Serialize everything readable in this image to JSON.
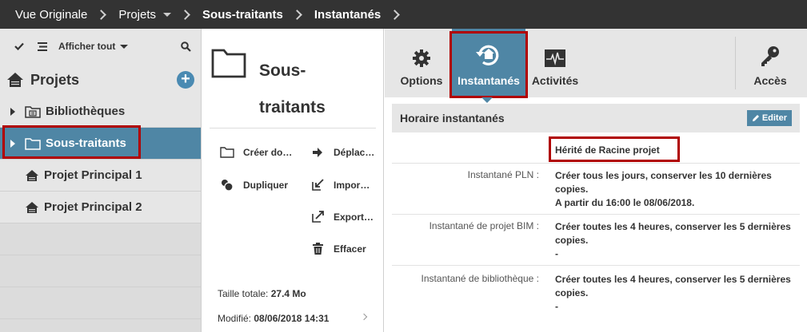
{
  "breadcrumb": {
    "items": [
      "Vue Originale",
      "Projets",
      "Sous-traitants",
      "Instantanés"
    ]
  },
  "left": {
    "toolbar": {
      "show_all": "Afficher tout"
    },
    "projects_title": "Projets",
    "tree": [
      {
        "label": "Bibliothèques",
        "icon": "library-folder-icon",
        "expandable": true,
        "selected": false
      },
      {
        "label": "Sous-traitants",
        "icon": "folder-icon",
        "expandable": true,
        "selected": true
      },
      {
        "label": "Projet Principal 1",
        "icon": "project-house-icon",
        "expandable": false,
        "selected": false
      },
      {
        "label": "Projet Principal 2",
        "icon": "project-house-icon",
        "expandable": false,
        "selected": false
      }
    ]
  },
  "middle": {
    "title_line1": "Sous-",
    "title_line2": "traitants",
    "actions": {
      "create": "Créer do…",
      "move": "Déplac…",
      "duplicate": "Dupliquer",
      "import": "Impor…",
      "export": "Export…",
      "delete": "Effacer"
    },
    "size_label": "Taille totale:",
    "size_value": "27.4 Mo",
    "modified_label": "Modifié:",
    "modified_value": "08/06/2018 14:31"
  },
  "right": {
    "tabs": {
      "options": "Options",
      "snapshots": "Instantanés",
      "activities": "Activités",
      "access": "Accès"
    },
    "section_title": "Horaire instantanés",
    "edit_label": "Editer",
    "inherited": "Hérité de Racine projet",
    "rows": [
      {
        "label": "Instantané PLN :",
        "value_line1": "Créer tous les jours, conserver les 10 dernières",
        "value_line2": "copies.",
        "value_line3": "A partir du 16:00 le 08/06/2018."
      },
      {
        "label": "Instantané de projet BIM :",
        "value_line1": "Créer toutes les 4 heures, conserver les 5 dernières",
        "value_line2": "copies.",
        "value_line3": "-"
      },
      {
        "label": "Instantané de bibliothèque :",
        "value_line1": "Créer toutes les 4 heures, conserver les 5 dernières",
        "value_line2": "copies.",
        "value_line3": "-"
      }
    ]
  },
  "colors": {
    "accent": "#4f86a5",
    "highlight_border": "#b00000",
    "topbar": "#333333"
  }
}
